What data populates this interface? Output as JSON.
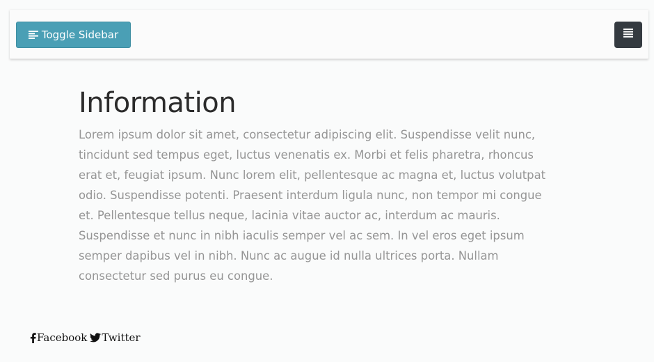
{
  "navbar": {
    "toggle_label": "Toggle Sidebar",
    "toggle_icon": "align-left-icon",
    "menu_icon": "hamburger-menu-icon"
  },
  "main": {
    "title": "Information",
    "paragraph": "Lorem ipsum dolor sit amet, consectetur adipiscing elit. Suspendisse velit nunc,\ntincidunt sed tempus eget, luctus venenatis ex. Morbi et felis pharetra, rhoncus\nerat et, feugiat ipsum. Nunc lorem elit, pellentesque ac magna et, luctus volutpat\nodio. Suspendisse potenti. Praesent interdum ligula nunc, non tempor mi congue\net. Pellentesque tellus neque, lacinia vitae auctor ac, interdum ac mauris.\nSuspendisse et nunc in nibh iaculis semper vel ac sem. In vel eros eget ipsum\nsemper dapibus vel in nibh. Nunc ac augue id nulla ultrices porta. Nullam\nconsectetur sed purus eu congue."
  },
  "footer": {
    "links": [
      {
        "label": "Facebook",
        "icon": "facebook-icon"
      },
      {
        "label": "Twitter",
        "icon": "twitter-icon"
      }
    ]
  },
  "colors": {
    "toggle_button_bg": "#4a9fb5",
    "menu_button_bg": "#343a40",
    "title_text": "#2b2b2b",
    "body_text": "#959595",
    "page_bg": "#fafbfb"
  }
}
